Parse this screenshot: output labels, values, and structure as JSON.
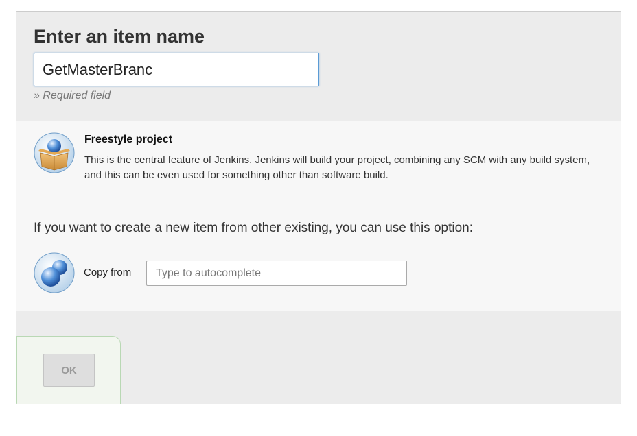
{
  "header": {
    "title": "Enter an item name",
    "item_name_value": "GetMasterBranc",
    "required_note": "» Required field"
  },
  "item_types": [
    {
      "name": "Freestyle project",
      "description": "This is the central feature of Jenkins. Jenkins will build your project, combining any SCM with any build system, and this can be even used for something other than software build.",
      "icon": "freestyle-box-icon"
    }
  ],
  "copy": {
    "intro": "If you want to create a new item from other existing, you can use this option:",
    "label": "Copy from",
    "placeholder": "Type to autocomplete",
    "value": "",
    "icon": "copy-spheres-icon"
  },
  "footer": {
    "ok_label": "OK",
    "ok_enabled": false
  },
  "colors": {
    "input_focus_border": "#5b9bd5",
    "panel_bg": "#ececec",
    "section_bg": "#f7f7f7",
    "ok_area_border": "#b9d8b4",
    "ok_disabled_bg": "#dedede"
  }
}
